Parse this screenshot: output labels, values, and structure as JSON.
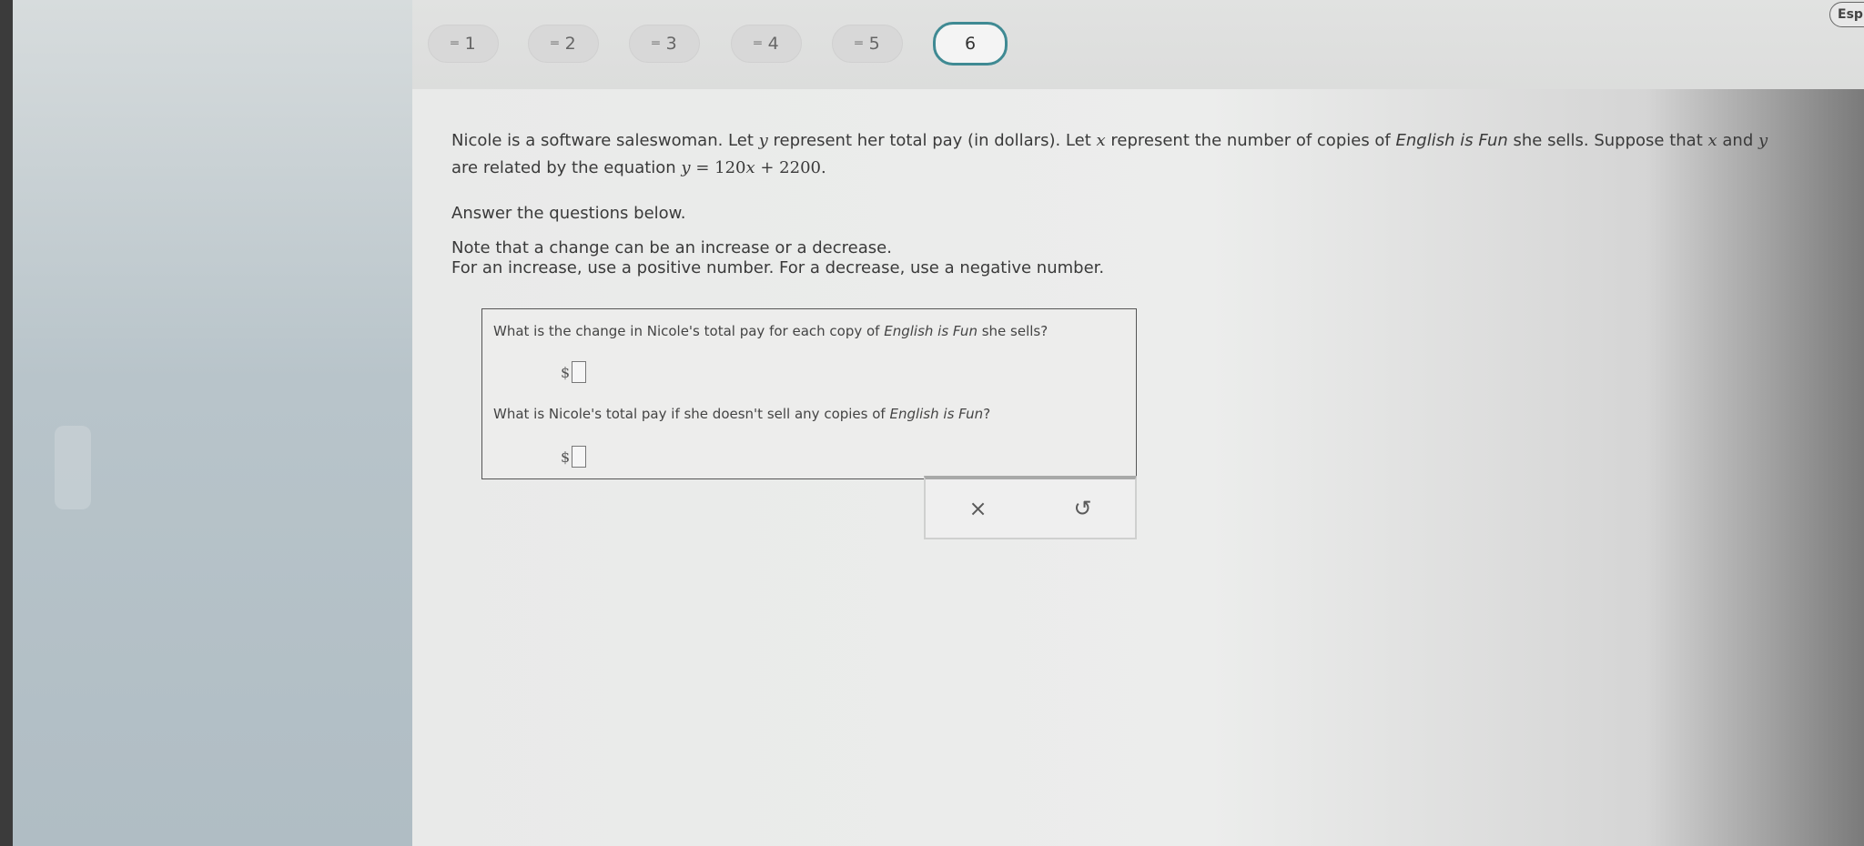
{
  "nav": {
    "questions": [
      {
        "label": "1"
      },
      {
        "label": "2"
      },
      {
        "label": "3"
      },
      {
        "label": "4"
      },
      {
        "label": "5"
      },
      {
        "label": "6"
      }
    ],
    "active_index": 6,
    "lang_button": "Esp"
  },
  "problem": {
    "line1_a": "Nicole is a software saleswoman. Let ",
    "var_y": "y",
    "line1_b": " represent her total pay (in dollars). Let ",
    "var_x": "x",
    "line1_c": " represent the number of copies of ",
    "product": "English is Fun",
    "line1_d": " she sells. Suppose that ",
    "line1_e": " and ",
    "line2_a": "are related by the equation ",
    "equation_y": "y",
    "equation_mid": " = 120",
    "equation_x": "x",
    "equation_end": " + 2200.",
    "instructions": "Answer the questions below.",
    "note1": "Note that a change can be an increase or a decrease.",
    "note2": "For an increase, use a positive number. For a decrease, use a negative number."
  },
  "questions": {
    "q1_a": "What is the change in Nicole's total pay for each copy of ",
    "q1_product": "English is Fun",
    "q1_b": " she sells?",
    "q2_a": "What is Nicole's total pay if she doesn't sell any copies of ",
    "q2_product": "English is Fun",
    "q2_b": "?",
    "currency": "$",
    "answer1": "",
    "answer2": ""
  },
  "actions": {
    "clear": "×",
    "undo": "↺"
  }
}
